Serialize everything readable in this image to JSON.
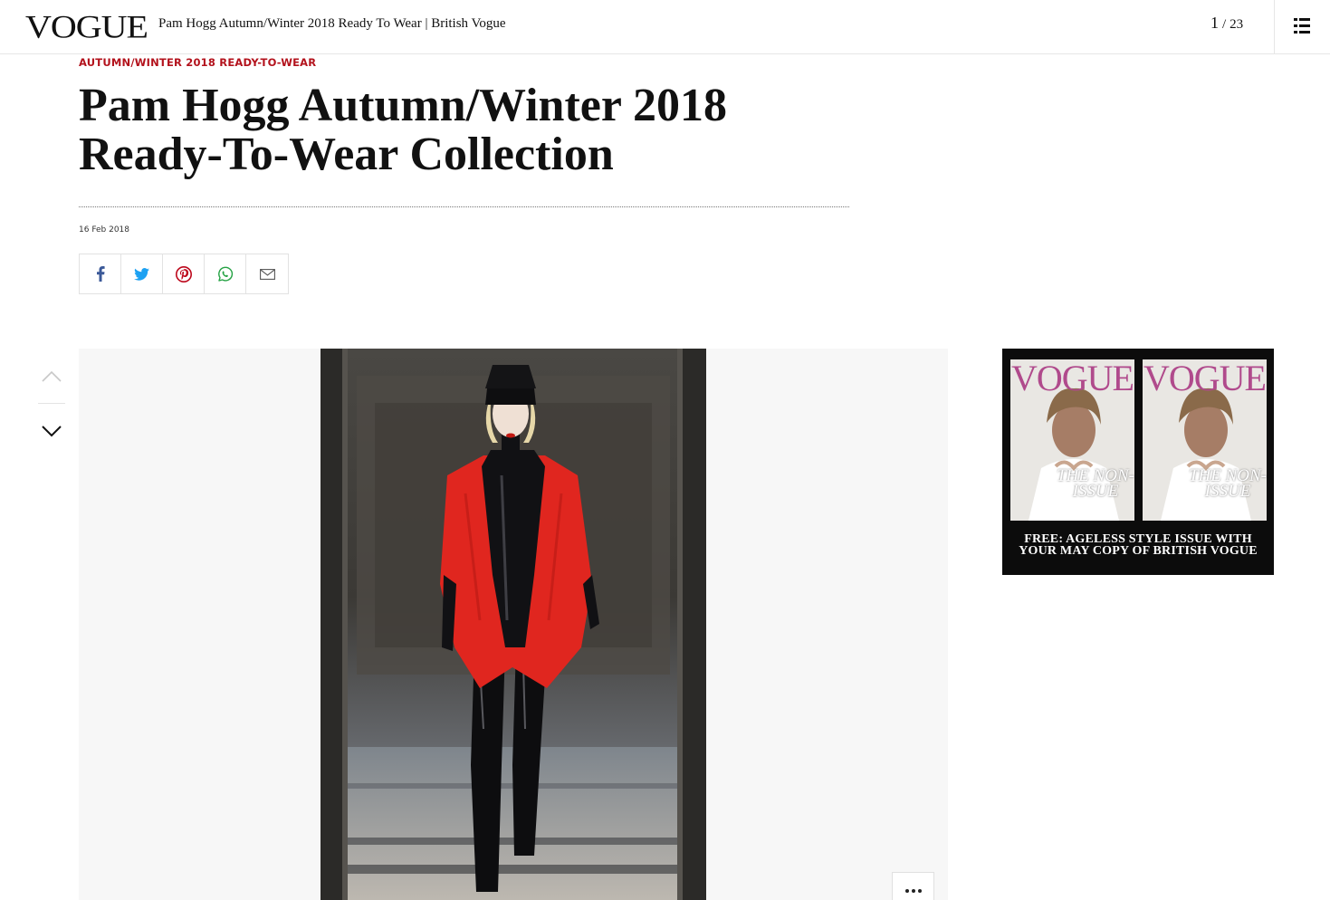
{
  "header": {
    "logo": "VOGUE",
    "page_title": "Pam Hogg Autumn/Winter 2018 Ready To Wear | British Vogue",
    "counter_current": "1",
    "counter_sep": "/",
    "counter_total": "23",
    "menu_icon": "list-menu-icon"
  },
  "article": {
    "kicker": "AUTUMN/WINTER 2018 READY-TO-WEAR",
    "headline_line1": "Pam Hogg Autumn/Winter 2018",
    "headline_line2": "Ready-To-Wear Collection",
    "date": "16 Feb 2018"
  },
  "share": {
    "buttons": [
      {
        "icon": "facebook-icon",
        "color": "#3b5998"
      },
      {
        "icon": "twitter-icon",
        "color": "#1da1f2"
      },
      {
        "icon": "pinterest-icon",
        "color": "#bd081c"
      },
      {
        "icon": "whatsapp-icon",
        "color": "#25a244"
      },
      {
        "icon": "email-icon",
        "color": "#555555"
      }
    ]
  },
  "gallery": {
    "nav_up_icon": "chevron-up-icon",
    "nav_down_icon": "chevron-down-icon",
    "more_icon": "more-options-icon"
  },
  "ad": {
    "cover_logo": "VOGUE",
    "cover_headline": "THE NON-ISSUE",
    "text_line1": "FREE: AGELESS STYLE ISSUE WITH",
    "text_line2": "YOUR MAY COPY OF BRITISH VOGUE"
  },
  "colors": {
    "kicker": "#b3121c",
    "stage_bg": "#f7f7f7",
    "ad_bg": "#0c0c0c",
    "cover_logo": "#b04a8c"
  }
}
